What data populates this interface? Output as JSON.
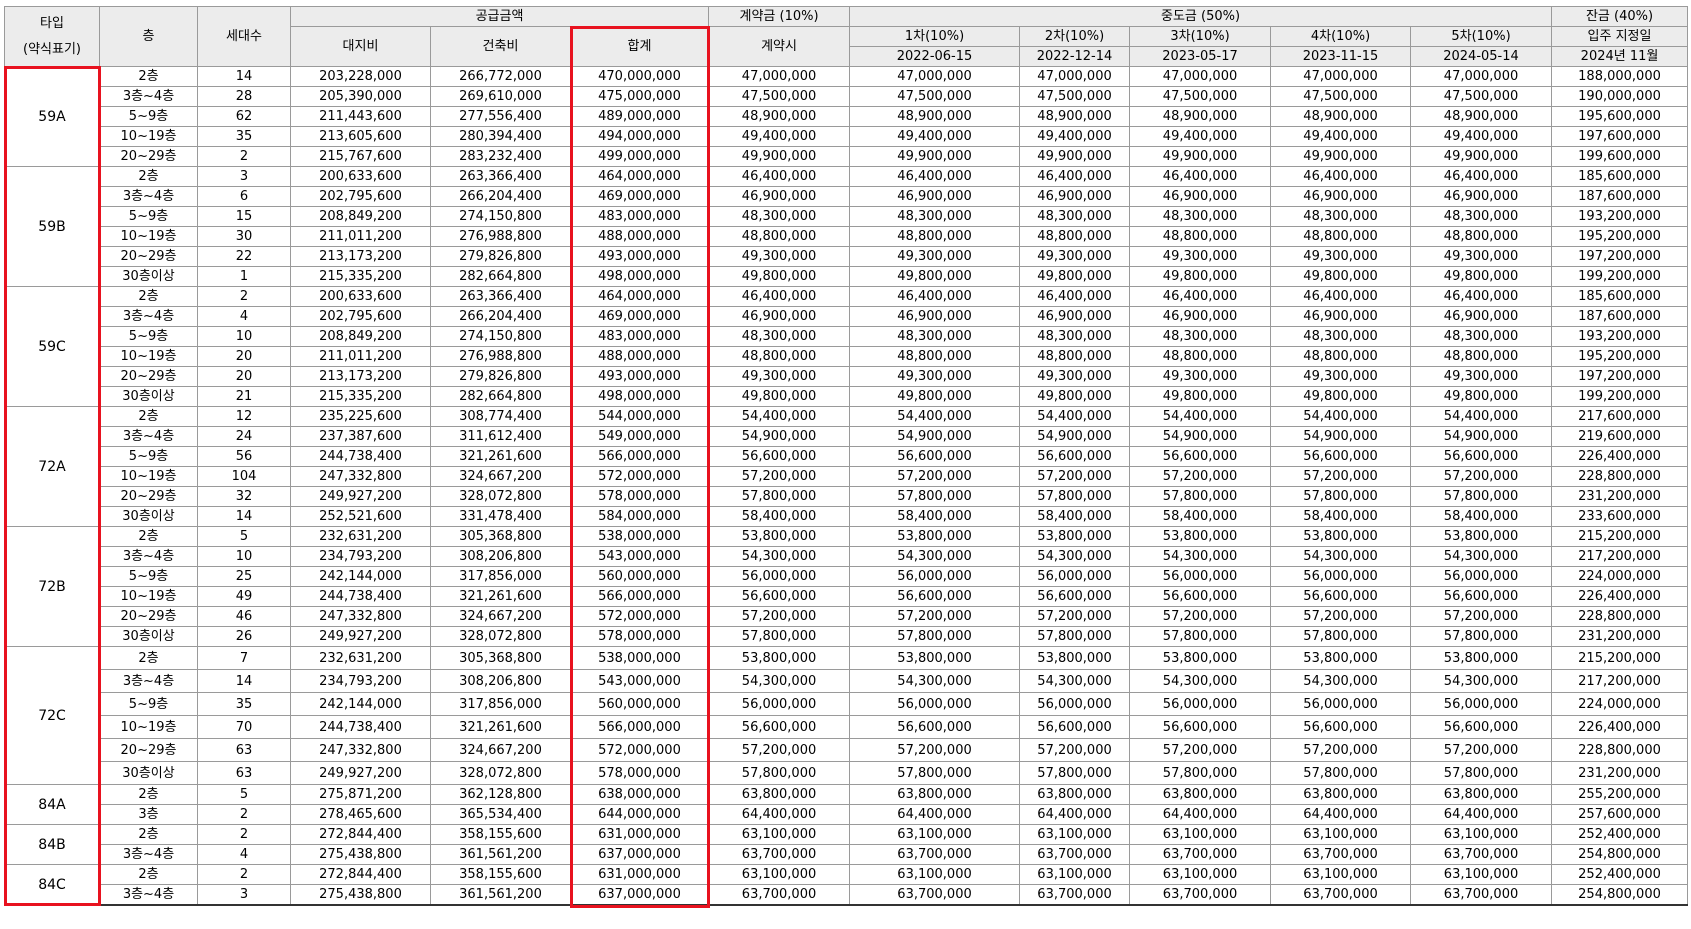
{
  "header": {
    "type_title": "타입",
    "type_sub": "(약식표기)",
    "floor": "층",
    "households": "세대수",
    "supply_group": "공급금액",
    "land": "대지비",
    "building": "건축비",
    "total": "합계",
    "contract_group": "계약금 (10%)",
    "contract_when": "계약시",
    "middle_group": "중도금 (50%)",
    "installments": [
      {
        "label": "1차(10%)",
        "date": "2022-06-15"
      },
      {
        "label": "2차(10%)",
        "date": "2022-12-14"
      },
      {
        "label": "3차(10%)",
        "date": "2023-05-17"
      },
      {
        "label": "4차(10%)",
        "date": "2023-11-15"
      },
      {
        "label": "5차(10%)",
        "date": "2024-05-14"
      }
    ],
    "balance_group": "잔금 (40%)",
    "balance_when": "입주 지정일",
    "balance_date": "2024년 11월"
  },
  "groups": [
    {
      "type": "59A",
      "rows": [
        {
          "floor": "2층",
          "households": "14",
          "land": "203,228,000",
          "building": "266,772,000",
          "total": "470,000,000",
          "contract": "47,000,000",
          "middle": "47,000,000",
          "balance": "188,000,000"
        },
        {
          "floor": "3층~4층",
          "households": "28",
          "land": "205,390,000",
          "building": "269,610,000",
          "total": "475,000,000",
          "contract": "47,500,000",
          "middle": "47,500,000",
          "balance": "190,000,000"
        },
        {
          "floor": "5~9층",
          "households": "62",
          "land": "211,443,600",
          "building": "277,556,400",
          "total": "489,000,000",
          "contract": "48,900,000",
          "middle": "48,900,000",
          "balance": "195,600,000"
        },
        {
          "floor": "10~19층",
          "households": "35",
          "land": "213,605,600",
          "building": "280,394,400",
          "total": "494,000,000",
          "contract": "49,400,000",
          "middle": "49,400,000",
          "balance": "197,600,000"
        },
        {
          "floor": "20~29층",
          "households": "2",
          "land": "215,767,600",
          "building": "283,232,400",
          "total": "499,000,000",
          "contract": "49,900,000",
          "middle": "49,900,000",
          "balance": "199,600,000"
        }
      ]
    },
    {
      "type": "59B",
      "rows": [
        {
          "floor": "2층",
          "households": "3",
          "land": "200,633,600",
          "building": "263,366,400",
          "total": "464,000,000",
          "contract": "46,400,000",
          "middle": "46,400,000",
          "balance": "185,600,000"
        },
        {
          "floor": "3층~4층",
          "households": "6",
          "land": "202,795,600",
          "building": "266,204,400",
          "total": "469,000,000",
          "contract": "46,900,000",
          "middle": "46,900,000",
          "balance": "187,600,000"
        },
        {
          "floor": "5~9층",
          "households": "15",
          "land": "208,849,200",
          "building": "274,150,800",
          "total": "483,000,000",
          "contract": "48,300,000",
          "middle": "48,300,000",
          "balance": "193,200,000"
        },
        {
          "floor": "10~19층",
          "households": "30",
          "land": "211,011,200",
          "building": "276,988,800",
          "total": "488,000,000",
          "contract": "48,800,000",
          "middle": "48,800,000",
          "balance": "195,200,000"
        },
        {
          "floor": "20~29층",
          "households": "22",
          "land": "213,173,200",
          "building": "279,826,800",
          "total": "493,000,000",
          "contract": "49,300,000",
          "middle": "49,300,000",
          "balance": "197,200,000"
        },
        {
          "floor": "30층이상",
          "households": "1",
          "land": "215,335,200",
          "building": "282,664,800",
          "total": "498,000,000",
          "contract": "49,800,000",
          "middle": "49,800,000",
          "balance": "199,200,000"
        }
      ]
    },
    {
      "type": "59C",
      "rows": [
        {
          "floor": "2층",
          "households": "2",
          "land": "200,633,600",
          "building": "263,366,400",
          "total": "464,000,000",
          "contract": "46,400,000",
          "middle": "46,400,000",
          "balance": "185,600,000"
        },
        {
          "floor": "3층~4층",
          "households": "4",
          "land": "202,795,600",
          "building": "266,204,400",
          "total": "469,000,000",
          "contract": "46,900,000",
          "middle": "46,900,000",
          "balance": "187,600,000"
        },
        {
          "floor": "5~9층",
          "households": "10",
          "land": "208,849,200",
          "building": "274,150,800",
          "total": "483,000,000",
          "contract": "48,300,000",
          "middle": "48,300,000",
          "balance": "193,200,000"
        },
        {
          "floor": "10~19층",
          "households": "20",
          "land": "211,011,200",
          "building": "276,988,800",
          "total": "488,000,000",
          "contract": "48,800,000",
          "middle": "48,800,000",
          "balance": "195,200,000"
        },
        {
          "floor": "20~29층",
          "households": "20",
          "land": "213,173,200",
          "building": "279,826,800",
          "total": "493,000,000",
          "contract": "49,300,000",
          "middle": "49,300,000",
          "balance": "197,200,000"
        },
        {
          "floor": "30층이상",
          "households": "21",
          "land": "215,335,200",
          "building": "282,664,800",
          "total": "498,000,000",
          "contract": "49,800,000",
          "middle": "49,800,000",
          "balance": "199,200,000"
        }
      ]
    },
    {
      "type": "72A",
      "rows": [
        {
          "floor": "2층",
          "households": "12",
          "land": "235,225,600",
          "building": "308,774,400",
          "total": "544,000,000",
          "contract": "54,400,000",
          "middle": "54,400,000",
          "balance": "217,600,000"
        },
        {
          "floor": "3층~4층",
          "households": "24",
          "land": "237,387,600",
          "building": "311,612,400",
          "total": "549,000,000",
          "contract": "54,900,000",
          "middle": "54,900,000",
          "balance": "219,600,000"
        },
        {
          "floor": "5~9층",
          "households": "56",
          "land": "244,738,400",
          "building": "321,261,600",
          "total": "566,000,000",
          "contract": "56,600,000",
          "middle": "56,600,000",
          "balance": "226,400,000"
        },
        {
          "floor": "10~19층",
          "households": "104",
          "land": "247,332,800",
          "building": "324,667,200",
          "total": "572,000,000",
          "contract": "57,200,000",
          "middle": "57,200,000",
          "balance": "228,800,000"
        },
        {
          "floor": "20~29층",
          "households": "32",
          "land": "249,927,200",
          "building": "328,072,800",
          "total": "578,000,000",
          "contract": "57,800,000",
          "middle": "57,800,000",
          "balance": "231,200,000"
        },
        {
          "floor": "30층이상",
          "households": "14",
          "land": "252,521,600",
          "building": "331,478,400",
          "total": "584,000,000",
          "contract": "58,400,000",
          "middle": "58,400,000",
          "balance": "233,600,000"
        }
      ]
    },
    {
      "type": "72B",
      "rows": [
        {
          "floor": "2층",
          "households": "5",
          "land": "232,631,200",
          "building": "305,368,800",
          "total": "538,000,000",
          "contract": "53,800,000",
          "middle": "53,800,000",
          "balance": "215,200,000"
        },
        {
          "floor": "3층~4층",
          "households": "10",
          "land": "234,793,200",
          "building": "308,206,800",
          "total": "543,000,000",
          "contract": "54,300,000",
          "middle": "54,300,000",
          "balance": "217,200,000"
        },
        {
          "floor": "5~9층",
          "households": "25",
          "land": "242,144,000",
          "building": "317,856,000",
          "total": "560,000,000",
          "contract": "56,000,000",
          "middle": "56,000,000",
          "balance": "224,000,000"
        },
        {
          "floor": "10~19층",
          "households": "49",
          "land": "244,738,400",
          "building": "321,261,600",
          "total": "566,000,000",
          "contract": "56,600,000",
          "middle": "56,600,000",
          "balance": "226,400,000"
        },
        {
          "floor": "20~29층",
          "households": "46",
          "land": "247,332,800",
          "building": "324,667,200",
          "total": "572,000,000",
          "contract": "57,200,000",
          "middle": "57,200,000",
          "balance": "228,800,000"
        },
        {
          "floor": "30층이상",
          "households": "26",
          "land": "249,927,200",
          "building": "328,072,800",
          "total": "578,000,000",
          "contract": "57,800,000",
          "middle": "57,800,000",
          "balance": "231,200,000"
        }
      ]
    },
    {
      "type": "72C",
      "tall": true,
      "rows": [
        {
          "floor": "2층",
          "households": "7",
          "land": "232,631,200",
          "building": "305,368,800",
          "total": "538,000,000",
          "contract": "53,800,000",
          "middle": "53,800,000",
          "balance": "215,200,000"
        },
        {
          "floor": "3층~4층",
          "households": "14",
          "land": "234,793,200",
          "building": "308,206,800",
          "total": "543,000,000",
          "contract": "54,300,000",
          "middle": "54,300,000",
          "balance": "217,200,000"
        },
        {
          "floor": "5~9층",
          "households": "35",
          "land": "242,144,000",
          "building": "317,856,000",
          "total": "560,000,000",
          "contract": "56,000,000",
          "middle": "56,000,000",
          "balance": "224,000,000"
        },
        {
          "floor": "10~19층",
          "households": "70",
          "land": "244,738,400",
          "building": "321,261,600",
          "total": "566,000,000",
          "contract": "56,600,000",
          "middle": "56,600,000",
          "balance": "226,400,000"
        },
        {
          "floor": "20~29층",
          "households": "63",
          "land": "247,332,800",
          "building": "324,667,200",
          "total": "572,000,000",
          "contract": "57,200,000",
          "middle": "57,200,000",
          "balance": "228,800,000"
        },
        {
          "floor": "30층이상",
          "households": "63",
          "land": "249,927,200",
          "building": "328,072,800",
          "total": "578,000,000",
          "contract": "57,800,000",
          "middle": "57,800,000",
          "balance": "231,200,000"
        }
      ]
    },
    {
      "type": "84A",
      "rows": [
        {
          "floor": "2층",
          "households": "5",
          "land": "275,871,200",
          "building": "362,128,800",
          "total": "638,000,000",
          "contract": "63,800,000",
          "middle": "63,800,000",
          "balance": "255,200,000"
        },
        {
          "floor": "3층",
          "households": "2",
          "land": "278,465,600",
          "building": "365,534,400",
          "total": "644,000,000",
          "contract": "64,400,000",
          "middle": "64,400,000",
          "balance": "257,600,000"
        }
      ]
    },
    {
      "type": "84B",
      "rows": [
        {
          "floor": "2층",
          "households": "2",
          "land": "272,844,400",
          "building": "358,155,600",
          "total": "631,000,000",
          "contract": "63,100,000",
          "middle": "63,100,000",
          "balance": "252,400,000"
        },
        {
          "floor": "3층~4층",
          "households": "4",
          "land": "275,438,800",
          "building": "361,561,200",
          "total": "637,000,000",
          "contract": "63,700,000",
          "middle": "63,700,000",
          "balance": "254,800,000"
        }
      ]
    },
    {
      "type": "84C",
      "rows": [
        {
          "floor": "2층",
          "households": "2",
          "land": "272,844,400",
          "building": "358,155,600",
          "total": "631,000,000",
          "contract": "63,100,000",
          "middle": "63,100,000",
          "balance": "252,400,000"
        },
        {
          "floor": "3층~4층",
          "households": "3",
          "land": "275,438,800",
          "building": "361,561,200",
          "total": "637,000,000",
          "contract": "63,700,000",
          "middle": "63,700,000",
          "balance": "254,800,000"
        }
      ]
    }
  ],
  "colors": {
    "highlight": "#e8121f",
    "header_bg": "#ececec",
    "grid": "#9a9a9a"
  }
}
